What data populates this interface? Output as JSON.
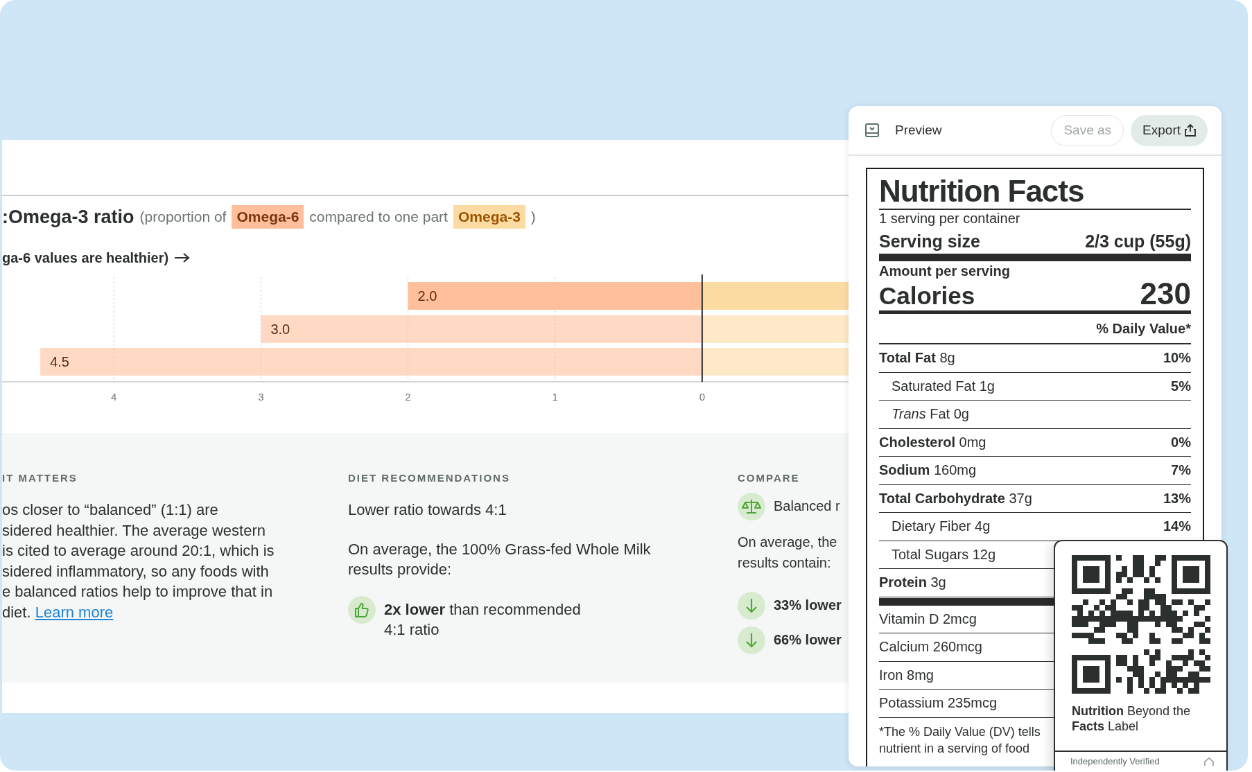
{
  "chart_header": {
    "title": ":Omega-3 ratio",
    "subtitle_parts": [
      {
        "kind": "text",
        "text": "(proportion of"
      },
      {
        "kind": "legend"
      },
      {
        "kind": "text",
        "text": "compared to one part"
      },
      {
        "kind": "legend"
      },
      {
        "kind": "text",
        "text": ")"
      }
    ],
    "axis_note": "ga-6 values are healthier)"
  },
  "chart_data": {
    "type": "bar",
    "orientation": "horizontal",
    "grid": true,
    "series": [
      {
        "name": "Omega-6",
        "color": "#ffbf9b",
        "values": [
          2.0,
          3.0,
          4.5
        ]
      },
      {
        "name": "Omega-3",
        "color": "#fcdba3",
        "values": [
          -1,
          -1,
          -1
        ]
      }
    ],
    "xlim": [
      4.76,
      -1
    ],
    "xticks": [
      4,
      3,
      2,
      1,
      0
    ],
    "value_labels": [
      "2.0",
      "3.0",
      "4.5"
    ]
  },
  "chart_rows": [
    {
      "selected": true
    },
    {
      "selected": false
    },
    {
      "selected": false
    }
  ],
  "sections": [
    {
      "heading": "IT MATTERS",
      "blocks": [
        {
          "kind": "paragraph",
          "text": "os closer to “balanced” (1:1) are\nsidered healthier. The average western\n is cited to average around 20:1, which is\nsidered inflammatory, so any foods with\ne balanced ratios help to improve that in\ndiet.",
          "link": "Learn more"
        }
      ]
    },
    {
      "heading": "DIET RECOMMENDATIONS",
      "blocks": [
        {
          "kind": "paragraph",
          "text": "Lower ratio towards 4:1"
        },
        {
          "kind": "paragraph",
          "text": "On average, the 100% Grass-fed Whole Milk\nresults provide:"
        },
        {
          "kind": "approval",
          "text": "**2x lower** than recommended\n4:1 ratio"
        }
      ]
    },
    {
      "heading": "COMPARE",
      "blocks": [
        {
          "kind": "balance",
          "text": "Balanced r"
        },
        {
          "kind": "paragraph",
          "text": "On average, the\nresults contain:"
        },
        {
          "kind": "decrease",
          "text": "**33% lower**"
        },
        {
          "kind": "decrease",
          "text": "**66% lower**"
        }
      ]
    }
  ],
  "preview_panel": {
    "title": "Preview",
    "buttons": [
      {
        "label": "Save as",
        "kind": "plain",
        "disabled": true
      },
      {
        "label": "Export",
        "kind": "share",
        "disabled": false
      }
    ]
  },
  "nutrition_label": {
    "title": "Nutrition Facts",
    "servings": "1 serving per container",
    "serving_size_label": "Serving size",
    "serving_size": "2/3 cup (55g)",
    "amount_label": "Amount per serving",
    "calories_label": "Calories",
    "calories": "230",
    "dv_header": "% Daily Value*",
    "rows": [
      {
        "kind": "main",
        "name": "Total Fat",
        "amount": "8g",
        "dv": "10%"
      },
      {
        "kind": "sub",
        "name": "Saturated Fat",
        "amount": "1g",
        "dv": "5%"
      },
      {
        "kind": "sub",
        "name": "*Trans* Fat",
        "amount": "0g"
      },
      {
        "kind": "main",
        "name": "Cholesterol",
        "amount": "0mg",
        "dv": "0%"
      },
      {
        "kind": "main",
        "name": "Sodium",
        "amount": "160mg",
        "dv": "7%"
      },
      {
        "kind": "main",
        "name": "Total Carbohydrate",
        "amount": "37g",
        "dv": "13%"
      },
      {
        "kind": "sub",
        "name": "Dietary Fiber",
        "amount": "4g",
        "dv": "14%"
      },
      {
        "kind": "sub",
        "name": "Total Sugars",
        "amount": "12g"
      },
      {
        "kind": "main",
        "name": "Protein",
        "amount": "3g"
      },
      {
        "kind": "vitamin",
        "name": "Vitamin D",
        "amount": "2mcg"
      },
      {
        "kind": "vitamin",
        "name": "Calcium",
        "amount": "260mcg"
      },
      {
        "kind": "vitamin",
        "name": "Iron",
        "amount": "8mg"
      },
      {
        "kind": "vitamin",
        "name": "Potassium",
        "amount": "235mcg"
      }
    ],
    "footnote": "*The % Daily Value (DV) tells\nnutrient in a serving of food"
  },
  "qr_card": {
    "caption": "**Nutrition** Beyond the\n**Facts** Label",
    "verified": "Independently Verified"
  }
}
